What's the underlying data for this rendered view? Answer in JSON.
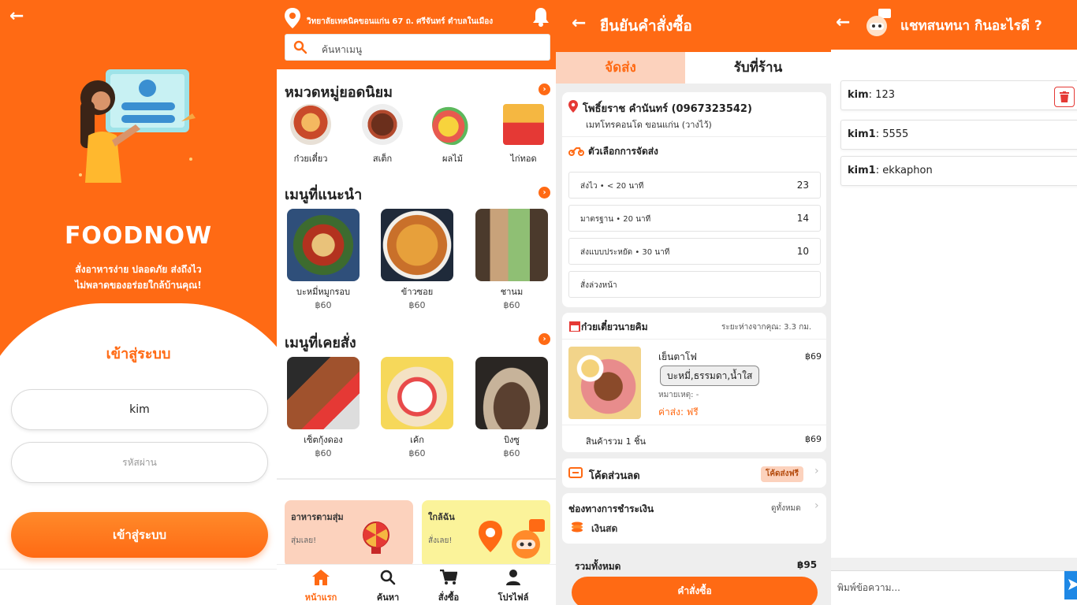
{
  "login": {
    "brand": "FOODNOW",
    "tagline1": "สั่งอาหารง่าย ปลอดภัย ส่งถึงไว",
    "tagline2": "ไม่พลาดของอร่อยใกล้บ้านคุณ!",
    "title": "เข้าสู่ระบบ",
    "username_value": "kim",
    "password_placeholder": "รหัสผ่าน",
    "login_button": "เข้าสู่ระบบ"
  },
  "home": {
    "address": "วิทยาลัยเทคนิคขอนแก่น 67 ถ. ศรีจันทร์ ตำบลในเมือง",
    "search_placeholder": "ค้นหาเมนู",
    "sections": {
      "categories": "หมวดหมู่ยอดนิยม",
      "recommended": "เมนูที่แนะนำ",
      "ordered": "เมนูที่เคยสั่ง"
    },
    "categories": [
      {
        "label": "ก๋วยเตี๋ยว"
      },
      {
        "label": "สเต็ก"
      },
      {
        "label": "ผลไม้"
      },
      {
        "label": "ไก่ทอด"
      }
    ],
    "recommended": [
      {
        "name": "บะหมี่หมูกรอบ",
        "price": "฿60"
      },
      {
        "name": "ข้าวซอย",
        "price": "฿60"
      },
      {
        "name": "ชานม",
        "price": "฿60"
      }
    ],
    "ordered": [
      {
        "name": "เซ็ตกุ้งดอง",
        "price": "฿60"
      },
      {
        "name": "เค้ก",
        "price": "฿60"
      },
      {
        "name": "บิงซู",
        "price": "฿60"
      }
    ],
    "promos": [
      {
        "title": "อาหารตามสุ่ม",
        "sub": "สุ่มเลย!"
      },
      {
        "title": "ใกล้ฉัน",
        "sub": "สั่งเลย!"
      }
    ],
    "nav": [
      {
        "label": "หน้าแรก"
      },
      {
        "label": "ค้นหา"
      },
      {
        "label": "สั่งซื้อ"
      },
      {
        "label": "โปรไฟล์"
      }
    ]
  },
  "checkout": {
    "title": "ยืนยันคำสั่งซื้อ",
    "tab_delivery": "จัดส่ง",
    "tab_pickup": "รับที่ร้าน",
    "receiver": "โพธิ์ยราช คำนันทร์ (0967323542)",
    "address": "เมทโทรคอนโด ขอนแก่น (วางไว้)",
    "delivery_options_title": "ตัวเลือกการจัดส่ง",
    "delivery_options": [
      {
        "label": "ส่งไว • < 20 นาที",
        "price": "23"
      },
      {
        "label": "มาตรฐาน • 20 นาที",
        "price": "14"
      },
      {
        "label": "ส่งแบบประหยัด • 30 นาที",
        "price": "10"
      },
      {
        "label": "สั่งล่วงหน้า",
        "price": ""
      }
    ],
    "shop_name": "ก๋วยเตี๋ยวนายคิม",
    "distance": "ระยะห่างจากคุณ: 3.3 กม.",
    "dish_name": "เย็นตาโฟ",
    "dish_price": "฿69",
    "dish_tag": "บะหมี่,ธรรมดา,น้ำใส",
    "dish_note": "หมายเหตุ: -",
    "dish_shipping": "ค่าส่ง: ฟรี",
    "items_total_label": "สินค้ารวม 1 ชิ้น",
    "items_total_value": "฿69",
    "discount_label": "โค้ดส่วนลด",
    "discount_badge": "โค้ดส่งฟรี",
    "payment_label": "ช่องทางการชำระเงิน",
    "payment_view_all": "ดูทั้งหมด",
    "payment_method": "เงินสด",
    "grand_total_label": "รวมทั้งหมด",
    "grand_total_value": "฿95",
    "order_button": "คำสั่งซื้อ"
  },
  "chat": {
    "title": "แชทสนทนา กินอะไรดี ?",
    "messages": [
      {
        "user": "kim",
        "text": "123"
      },
      {
        "user": "kim1",
        "text": "5555"
      },
      {
        "user": "kim1",
        "text": "ekkaphon"
      }
    ],
    "input_placeholder": "พิมพ์ข้อความ..."
  },
  "colors": {
    "accent": "#ff6a14",
    "accent_light": "#fcd2bd",
    "send": "#1e88e5",
    "danger": "#e53935"
  }
}
